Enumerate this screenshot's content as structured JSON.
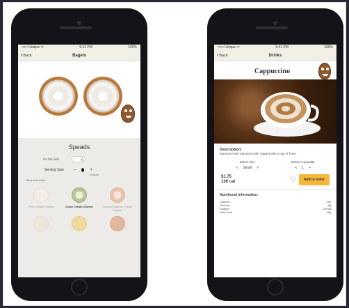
{
  "left_screen": {
    "status": {
      "carrier": "••••• Unique ᯤ",
      "time": "9:41 PM",
      "battery": "100%"
    },
    "nav": {
      "back_label": "Back",
      "title": "Bagels"
    },
    "spreads_heading": "Speads",
    "on_the_side_label": "On the side",
    "serving_size_label": "Serving Size",
    "serving_size_decrement": "–",
    "serving_size_increment": "+",
    "serving_size_value": "Regular",
    "note": "* Best with a little...",
    "options": [
      {
        "label": "Plain Cream Cheese",
        "selected": false,
        "color": "#f2ede6"
      },
      {
        "label": "Chive Cream Cheese",
        "selected": true,
        "color": "#b8c79a"
      },
      {
        "label": "Smoked Salmon Cream Cheese",
        "selected": false,
        "color": "#e8c4ae"
      },
      {
        "label": "",
        "selected": false,
        "color": "#eee7d8"
      },
      {
        "label": "",
        "selected": false,
        "color": "#efdba0"
      },
      {
        "label": "",
        "selected": false,
        "color": "#e2b8a0"
      }
    ]
  },
  "right_screen": {
    "status": {
      "carrier": "••••• Unique ᯤ",
      "time": "9:41 PM",
      "battery": "100%"
    },
    "nav": {
      "back_label": "Back",
      "title": "Drinks"
    },
    "product_title": "Cappuccino",
    "description_heading": "Description:",
    "description_text": "Espresso with steamed milk, topped with a cap of foam",
    "select_size_label": "Select size",
    "select_size_decrement": "<",
    "select_size_value": "Small",
    "select_size_increment": ">",
    "select_quantity_label": "Select a quantity",
    "select_quantity_decrement": "<",
    "select_quantity_value": "1",
    "select_quantity_increment": ">",
    "price": "$1.75",
    "calories": "130 cal",
    "add_to_order_label": "Add to order",
    "nutrition_heading": "Nutritional Information:",
    "nutrition": [
      {
        "name": "Calories",
        "value": "130"
      },
      {
        "name": "Total fat",
        "value": "6g"
      },
      {
        "name": "Sodium",
        "value": "120mg"
      },
      {
        "name": "Total Carb",
        "value": "15g"
      }
    ]
  },
  "colors": {
    "background": "#2a2635",
    "panel": "#ecebe7",
    "accent": "#f5b73a",
    "nav": "#f2f0e6"
  }
}
